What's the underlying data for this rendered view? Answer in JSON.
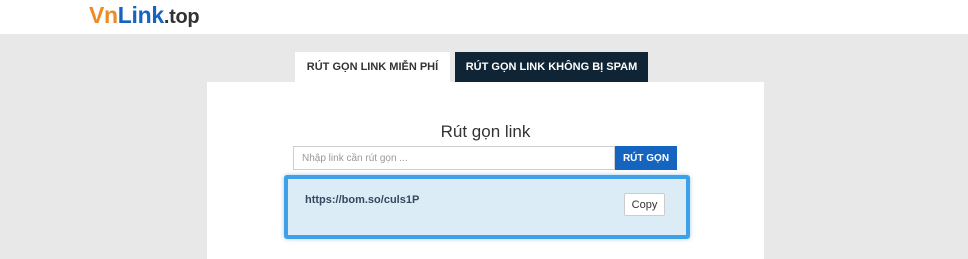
{
  "logo": {
    "part1": "Vn",
    "part2": "Link",
    "part3": ".top"
  },
  "tabs": {
    "free": "RÚT GỌN LINK MIỄN PHÍ",
    "no_spam": "RÚT GỌN LINK KHÔNG BỊ SPAM"
  },
  "main": {
    "title": "Rút gọn link",
    "input_placeholder": "Nhập link cần rút gọn ...",
    "input_value": "",
    "shorten_button": "RÚT GỌN"
  },
  "result": {
    "link": "https://bom.so/culs1P",
    "copy_button": "Copy"
  },
  "colors": {
    "brand_orange": "#f08a24",
    "brand_blue": "#1565c0",
    "tab_dark": "#0f2434",
    "highlight": "#3fa0e8"
  }
}
